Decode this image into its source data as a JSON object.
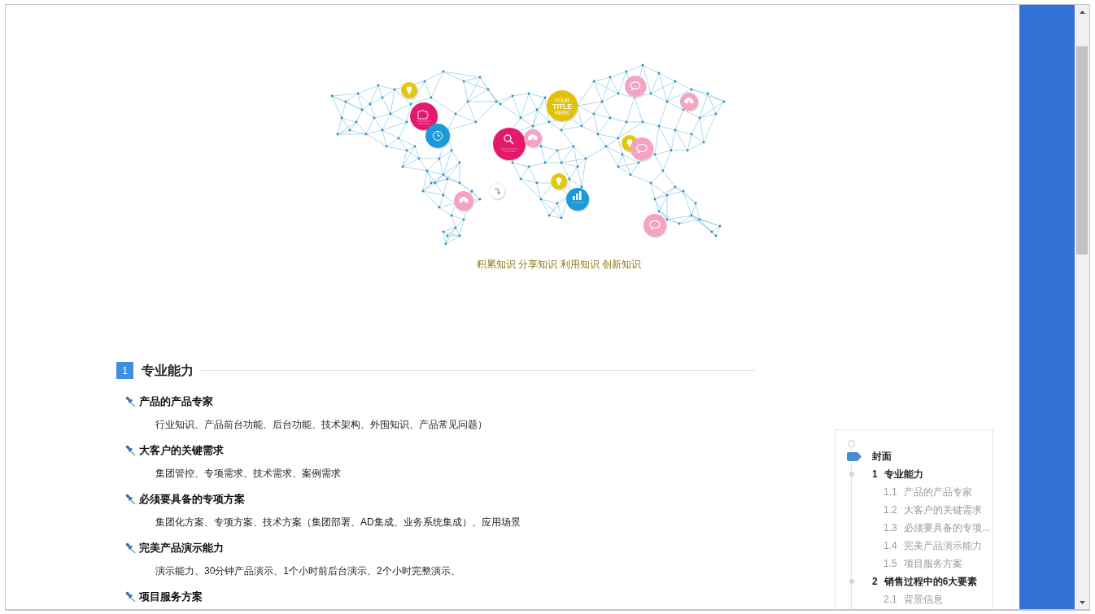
{
  "illustration": {
    "badge_lines": [
      "YOUR",
      "TITLE",
      "HERE"
    ],
    "caption": "积累知识 分享知识 利用知识 创新知识"
  },
  "section": {
    "number": "1",
    "title": "专业能力",
    "items": [
      {
        "title": "产品的产品专家",
        "description": "行业知识、产品前台功能、后台功能、技术架构、外围知识、产品常见问题）"
      },
      {
        "title": "大客户的关键需求",
        "description": "集团管控、专项需求、技术需求、案例需求"
      },
      {
        "title": "必须要具备的专项方案",
        "description": "集团化方案、专项方案、技术方案（集团部署、AD集成、业务系统集成）、应用场景"
      },
      {
        "title": "完美产品演示能力",
        "description": "演示能力、30分钟产品演示、1个小时前后台演示、2个小时完整演示、"
      },
      {
        "title": "项目服务方案"
      }
    ]
  },
  "toc": {
    "items": [
      {
        "label": "封面",
        "selected": true
      },
      {
        "number": "1",
        "label": "专业能力",
        "selected": false,
        "children": [
          {
            "number": "1.1",
            "label": "产品的产品专家",
            "selected": false
          },
          {
            "number": "1.2",
            "label": "大客户的关键需求",
            "selected": false
          },
          {
            "number": "1.3",
            "label": "必须要具备的专项...",
            "selected": false
          },
          {
            "number": "1.4",
            "label": "完美产品演示能力",
            "selected": false
          },
          {
            "number": "1.5",
            "label": "项目服务方案",
            "selected": false
          }
        ]
      },
      {
        "number": "2",
        "label": "销售过程中的6大要素",
        "selected": false,
        "children": [
          {
            "number": "2.1",
            "label": "背景信息",
            "selected": false
          }
        ]
      }
    ]
  }
}
